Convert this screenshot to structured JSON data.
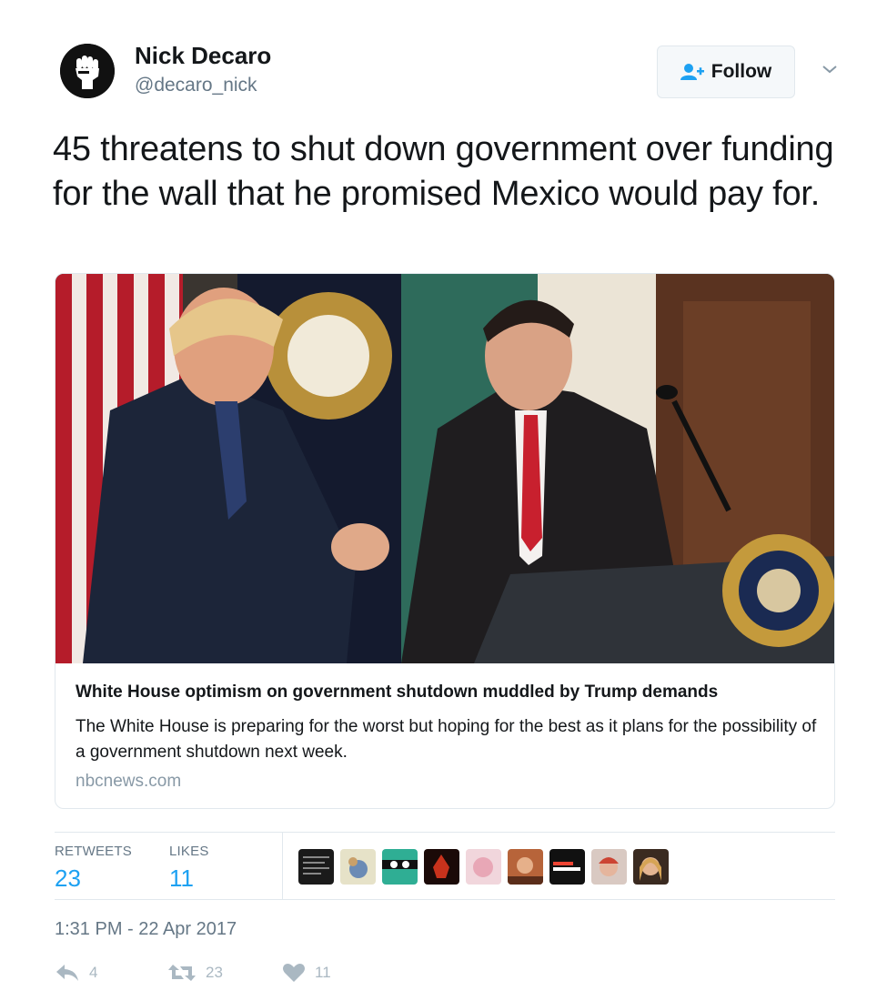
{
  "user": {
    "name": "Nick Decaro",
    "handle": "@decaro_nick",
    "avatar_icon": "raised-fist-icon"
  },
  "follow_button": {
    "label": "Follow",
    "icon": "add-user-icon"
  },
  "menu_icon": "chevron-down-icon",
  "tweet": {
    "text": "45 threatens to shut down government over funding for the wall that he promised Mexico would pay for."
  },
  "card": {
    "title": "White House optimism on government shutdown muddled by Trump demands",
    "description": "The White House is preparing for the worst but hoping for the best as it plans for the possibility of a government shutdown next week.",
    "domain": "nbcnews.com"
  },
  "stats": {
    "retweets_label": "RETWEETS",
    "retweets_count": "23",
    "likes_label": "LIKES",
    "likes_count": "11",
    "liker_avatar_count": 9
  },
  "timestamp": "1:31 PM - 22 Apr 2017",
  "actions": {
    "reply_count": "4",
    "retweet_count": "23",
    "like_count": "11"
  },
  "colors": {
    "accent": "#1da1f2",
    "muted": "#657786",
    "border": "#e1e8ed",
    "action_icon": "#aab8c2"
  }
}
